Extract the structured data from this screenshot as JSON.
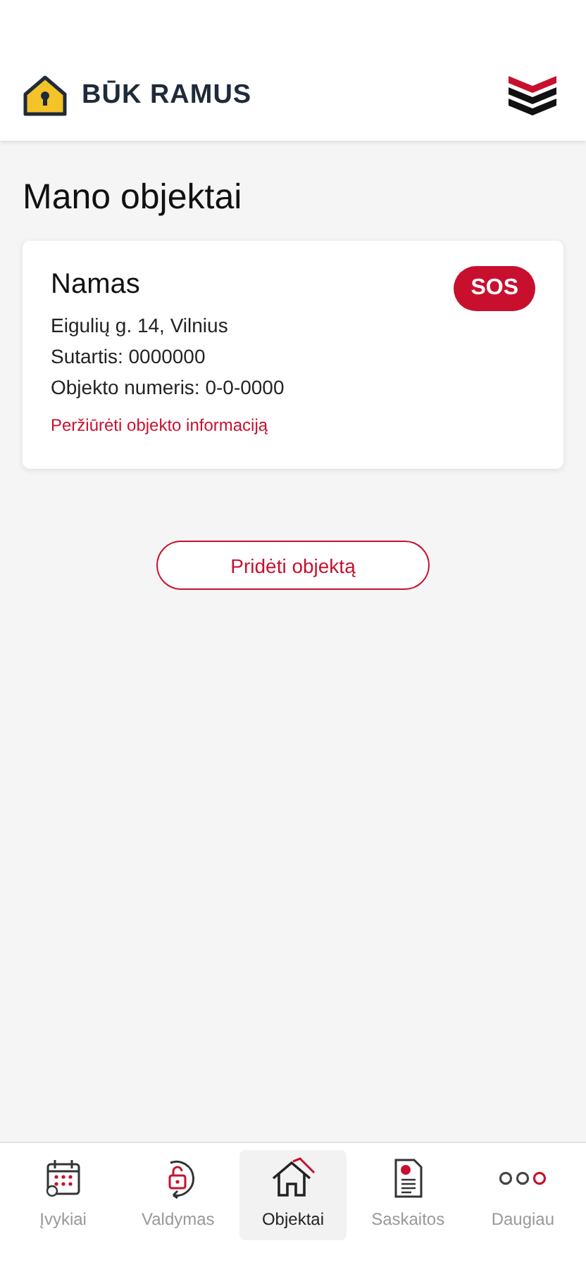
{
  "header": {
    "brand": "BŪK RAMUS"
  },
  "page_title": "Mano objektai",
  "objects": [
    {
      "name": "Namas",
      "address": "Eigulių g. 14, Vilnius",
      "contract": "Sutartis: 0000000",
      "number": "Objekto numeris: 0-0-0000",
      "link": "Peržiūrėti objekto informaciją",
      "sos": "SOS"
    }
  ],
  "add_button": "Pridėti objektą",
  "nav": [
    {
      "kind": "events",
      "label": "Įvykiai",
      "selected": false
    },
    {
      "kind": "control",
      "label": "Valdymas",
      "selected": false
    },
    {
      "kind": "objects",
      "label": "Objektai",
      "selected": true
    },
    {
      "kind": "invoices",
      "label": "Saskaitos",
      "selected": false
    },
    {
      "kind": "more",
      "label": "Daugiau",
      "selected": false
    }
  ]
}
